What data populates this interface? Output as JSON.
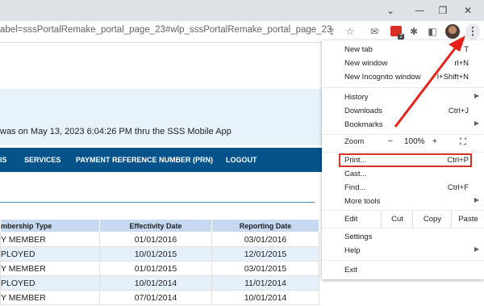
{
  "browser": {
    "url": "abel=sssPortalRemake_portal_page_23#wlp_sssPortalRemake_portal_page_23",
    "extension_badge_count": "2"
  },
  "page": {
    "notice": "was on May 13, 2023 6:04:26 PM thru the SSS Mobile App",
    "nav": [
      "IS",
      "SERVICES",
      "PAYMENT REFERENCE NUMBER (PRN)",
      "LOGOUT"
    ],
    "table": {
      "headers": [
        "mbership Type",
        "Effectivity Date",
        "Reporting Date"
      ],
      "rows": [
        [
          "Y MEMBER",
          "01/01/2016",
          "03/01/2016"
        ],
        [
          "PLOYED",
          "10/01/2015",
          "12/01/2015"
        ],
        [
          "Y MEMBER",
          "01/01/2015",
          "03/01/2015"
        ],
        [
          "PLOYED",
          "10/01/2014",
          "11/01/2014"
        ],
        [
          "Y MEMBER",
          "07/01/2014",
          "10/01/2014"
        ]
      ]
    }
  },
  "menu": {
    "new_tab": "New tab",
    "new_tab_sc": "T",
    "new_window": "New window",
    "new_window_sc": "rl+N",
    "incognito": "New Incognito window",
    "incognito_sc": "l+Shift+N",
    "history": "History",
    "downloads": "Downloads",
    "downloads_sc": "Ctrl+J",
    "bookmarks": "Bookmarks",
    "zoom": "Zoom",
    "zoom_minus": "−",
    "zoom_value": "100%",
    "zoom_plus": "+",
    "print": "Print...",
    "print_sc": "Ctrl+P",
    "cast": "Cast...",
    "find": "Find...",
    "find_sc": "Ctrl+F",
    "more_tools": "More tools",
    "edit": "Edit",
    "cut": "Cut",
    "copy": "Copy",
    "paste": "Paste",
    "settings": "Settings",
    "help": "Help",
    "exit": "Exit"
  },
  "colors": {
    "nav_bg": "#06538c",
    "highlight": "#d93025",
    "table_header": "#c6d9f1"
  }
}
